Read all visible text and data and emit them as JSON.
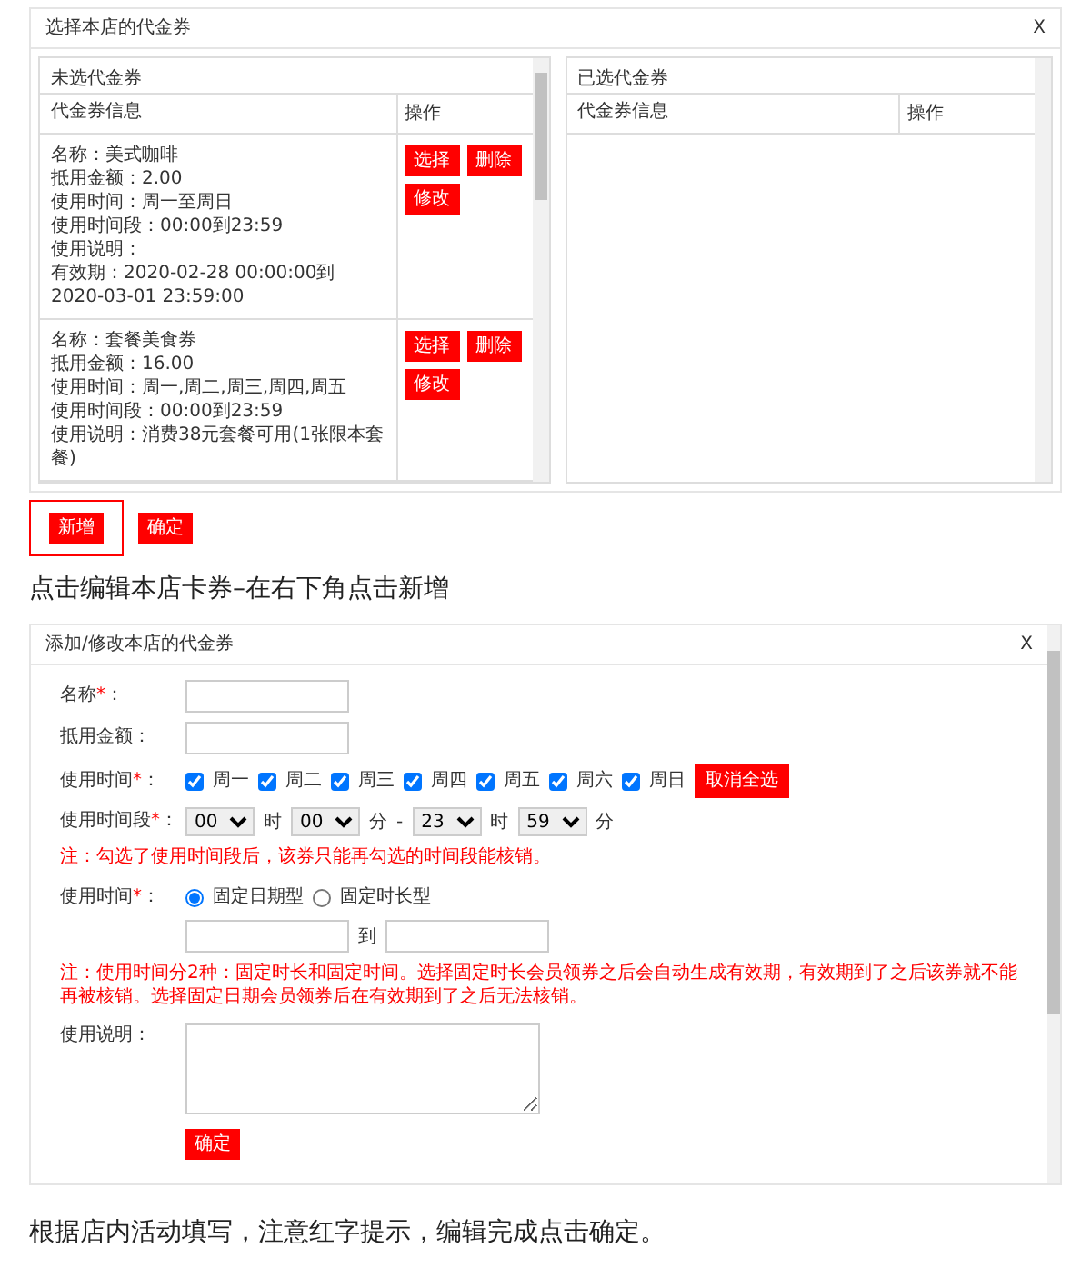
{
  "dialog_1": {
    "title": "选择本店的代金券",
    "close": "X",
    "unselected_panel": {
      "title": "未选代金券",
      "columns": [
        "代金券信息",
        "操作"
      ],
      "vouchers": [
        {
          "lines": [
            "名称：美式咖啡",
            "抵用金额：2.00",
            "使用时间：周一至周日",
            "使用时间段：00:00到23:59",
            "使用说明：",
            "有效期：2020-02-28 00:00:00到2020-03-01 23:59:00"
          ],
          "actions": [
            "选择",
            "删除",
            "修改"
          ]
        },
        {
          "lines": [
            "名称：套餐美食券",
            "抵用金额：16.00",
            "使用时间：周一,周二,周三,周四,周五",
            "使用时间段：00:00到23:59",
            "使用说明：消费38元套餐可用(1张限本套餐)"
          ],
          "actions": [
            "选择",
            "删除",
            "修改"
          ]
        }
      ]
    },
    "selected_panel": {
      "title": "已选代金券",
      "columns": [
        "代金券信息",
        "操作"
      ]
    },
    "buttons": [
      {
        "label": "新增",
        "highlighted": true
      },
      {
        "label": "确定",
        "highlighted": false
      }
    ]
  },
  "caption_1": "点击编辑本店卡券–在右下角点击新增",
  "dialog_2": {
    "title": "添加/修改本店的代金券",
    "close": "X",
    "name": {
      "label": "名称",
      "required_mark": "*",
      "colon": "："
    },
    "amount": {
      "label": "抵用金额",
      "colon": "："
    },
    "days": {
      "label": "使用时间",
      "required_mark": "*",
      "colon": "：",
      "options": [
        {
          "label": "周一",
          "checked": true
        },
        {
          "label": "周二",
          "checked": true
        },
        {
          "label": "周三",
          "checked": true
        },
        {
          "label": "周四",
          "checked": true
        },
        {
          "label": "周五",
          "checked": true
        },
        {
          "label": "周六",
          "checked": true
        },
        {
          "label": "周日",
          "checked": true
        }
      ],
      "toggle_button": "取消全选"
    },
    "time_range": {
      "label": "使用时间段",
      "required_mark": "*",
      "colon": "：",
      "parts": [
        {
          "kind": "select",
          "value": "00"
        },
        {
          "kind": "text",
          "text": "时"
        },
        {
          "kind": "select",
          "value": "00"
        },
        {
          "kind": "text",
          "text": "分"
        },
        {
          "kind": "text",
          "text": "-"
        },
        {
          "kind": "select",
          "value": "23"
        },
        {
          "kind": "text",
          "text": "时"
        },
        {
          "kind": "select",
          "value": "59"
        },
        {
          "kind": "text",
          "text": "分"
        }
      ]
    },
    "note_1": "注：勾选了使用时间段后，该券只能再勾选的时间段能核销。",
    "validity": {
      "label": "使用时间",
      "required_mark": "*",
      "colon": "：",
      "options": [
        {
          "label": "固定日期型",
          "selected": true
        },
        {
          "label": "固定时长型",
          "selected": false
        }
      ],
      "separator": "到"
    },
    "note_2": "注：使用时间分2种：固定时长和固定时间。选择固定时长会员领券之后会自动生成有效期，有效期到了之后该券就不能再被核销。选择固定日期会员领券后在有效期到了之后无法核销。",
    "description": {
      "label": "使用说明",
      "colon": "："
    },
    "confirm": "确定"
  },
  "caption_2": "根据店内活动填写，注意红字提示，编辑完成点击确定。"
}
